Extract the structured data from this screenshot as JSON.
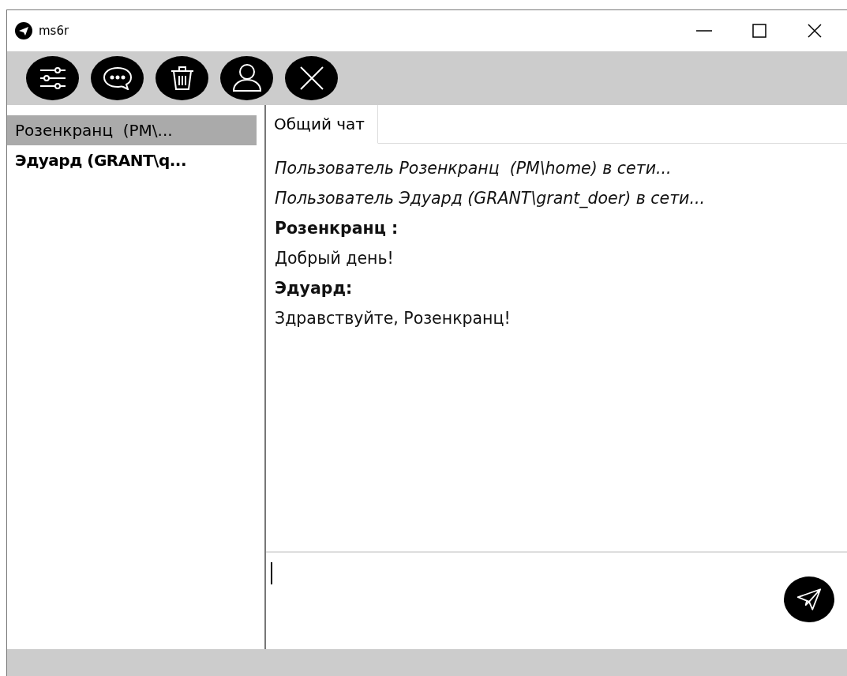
{
  "window": {
    "title": "ms6r"
  },
  "toolbar": {
    "buttons": [
      {
        "kind": "settings"
      },
      {
        "kind": "chat"
      },
      {
        "kind": "delete"
      },
      {
        "kind": "user"
      },
      {
        "kind": "close"
      }
    ]
  },
  "contacts": [
    {
      "name": "Розенкранц  (PM\\...",
      "selected": true,
      "unread": false
    },
    {
      "name": "Эдуард (GRANT\\q...",
      "selected": false,
      "unread": true
    }
  ],
  "tabs": [
    {
      "label": "Общий чат",
      "selected": true
    }
  ],
  "messages": [
    {
      "kind": "system",
      "text": "Пользователь Розенкранц  (PM\\home) в сети..."
    },
    {
      "kind": "system",
      "text": "Пользователь Эдуард (GRANT\\grant_doer) в сети..."
    },
    {
      "kind": "author",
      "text": "Розенкранц :"
    },
    {
      "kind": "text",
      "text": "Добрый день!"
    },
    {
      "kind": "author",
      "text": "Эдуард:"
    },
    {
      "kind": "text",
      "text": "Здравствуйте, Розенкранц!"
    }
  ],
  "composer": {
    "focused": true
  }
}
